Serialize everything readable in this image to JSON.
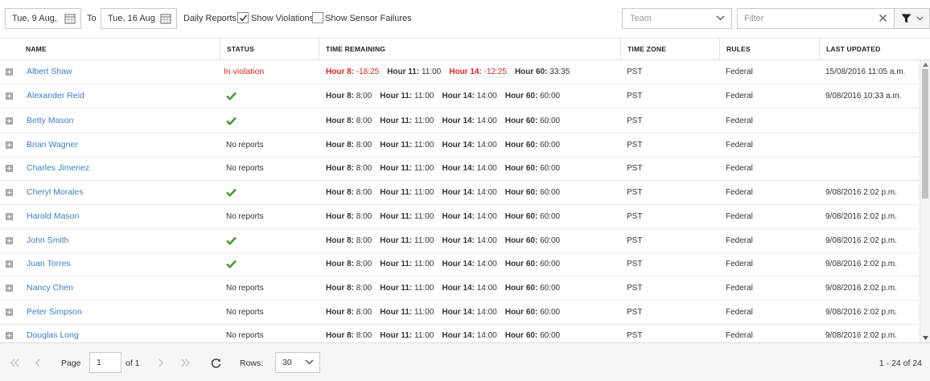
{
  "toolbar": {
    "from_date": "Tue, 9 Aug,",
    "to_label": "To",
    "to_date": "Tue, 16 Aug",
    "daily_reports_label": "Daily Reports:",
    "show_violations_label": "Show Violations",
    "show_violations_checked": true,
    "show_sensor_failures_label": "Show Sensor Failures",
    "show_sensor_failures_checked": false,
    "team_placeholder": "Team",
    "filter_placeholder": "Filter"
  },
  "columns": {
    "name": "NAME",
    "status": "STATUS",
    "time_remaining": "TIME REMAINING",
    "time_zone": "TIME ZONE",
    "rules": "RULES",
    "last_updated": "LAST UPDATED"
  },
  "rows": [
    {
      "name": "Albert Shaw",
      "status": "In violation",
      "status_type": "violation",
      "time": [
        {
          "label": "Hour 8:",
          "value": "-18:25",
          "red": true
        },
        {
          "label": "Hour 11:",
          "value": "11:00",
          "red": false
        },
        {
          "label": "Hour 14:",
          "value": "-12:25",
          "red": true
        },
        {
          "label": "Hour 60:",
          "value": "33:35",
          "red": false
        }
      ],
      "time_zone": "PST",
      "rules": "Federal",
      "last_updated": "15/08/2016 11:05 a.m."
    },
    {
      "name": "Alexander Reid",
      "status": "",
      "status_type": "ok",
      "time": [
        {
          "label": "Hour 8:",
          "value": "8:00"
        },
        {
          "label": "Hour 11:",
          "value": "11:00"
        },
        {
          "label": "Hour 14:",
          "value": "14:00"
        },
        {
          "label": "Hour 60:",
          "value": "60:00"
        }
      ],
      "time_zone": "PST",
      "rules": "Federal",
      "last_updated": "9/08/2016 10:33 a.m."
    },
    {
      "name": "Betty Mason",
      "status": "",
      "status_type": "ok",
      "time": [
        {
          "label": "Hour 8:",
          "value": "8:00"
        },
        {
          "label": "Hour 11:",
          "value": "11:00"
        },
        {
          "label": "Hour 14:",
          "value": "14:00"
        },
        {
          "label": "Hour 60:",
          "value": "60:00"
        }
      ],
      "time_zone": "PST",
      "rules": "Federal",
      "last_updated": ""
    },
    {
      "name": "Brian Wagner",
      "status": "No reports",
      "status_type": "none",
      "time": [
        {
          "label": "Hour 8:",
          "value": "8:00"
        },
        {
          "label": "Hour 11:",
          "value": "11:00"
        },
        {
          "label": "Hour 14:",
          "value": "14:00"
        },
        {
          "label": "Hour 60:",
          "value": "60:00"
        }
      ],
      "time_zone": "PST",
      "rules": "Federal",
      "last_updated": ""
    },
    {
      "name": "Charles Jimenez",
      "status": "No reports",
      "status_type": "none",
      "time": [
        {
          "label": "Hour 8:",
          "value": "8:00"
        },
        {
          "label": "Hour 11:",
          "value": "11:00"
        },
        {
          "label": "Hour 14:",
          "value": "14:00"
        },
        {
          "label": "Hour 60:",
          "value": "60:00"
        }
      ],
      "time_zone": "PST",
      "rules": "Federal",
      "last_updated": ""
    },
    {
      "name": "Cheryl Morales",
      "status": "",
      "status_type": "ok",
      "time": [
        {
          "label": "Hour 8:",
          "value": "8:00"
        },
        {
          "label": "Hour 11:",
          "value": "11:00"
        },
        {
          "label": "Hour 14:",
          "value": "14:00"
        },
        {
          "label": "Hour 60:",
          "value": "60:00"
        }
      ],
      "time_zone": "PST",
      "rules": "Federal",
      "last_updated": "9/08/2016 2:02 p.m."
    },
    {
      "name": "Harold Mason",
      "status": "No reports",
      "status_type": "none",
      "time": [
        {
          "label": "Hour 8:",
          "value": "8:00"
        },
        {
          "label": "Hour 11:",
          "value": "11:00"
        },
        {
          "label": "Hour 14:",
          "value": "14:00"
        },
        {
          "label": "Hour 60:",
          "value": "60:00"
        }
      ],
      "time_zone": "PST",
      "rules": "Federal",
      "last_updated": "9/08/2016 2:02 p.m."
    },
    {
      "name": "John Smith",
      "status": "",
      "status_type": "ok",
      "time": [
        {
          "label": "Hour 8:",
          "value": "8:00"
        },
        {
          "label": "Hour 11:",
          "value": "11:00"
        },
        {
          "label": "Hour 14:",
          "value": "14:00"
        },
        {
          "label": "Hour 60:",
          "value": "60:00"
        }
      ],
      "time_zone": "PST",
      "rules": "Federal",
      "last_updated": "9/08/2016 2:02 p.m."
    },
    {
      "name": "Juan Torres",
      "status": "",
      "status_type": "ok",
      "time": [
        {
          "label": "Hour 8:",
          "value": "8:00"
        },
        {
          "label": "Hour 11:",
          "value": "11:00"
        },
        {
          "label": "Hour 14:",
          "value": "14:00"
        },
        {
          "label": "Hour 60:",
          "value": "60:00"
        }
      ],
      "time_zone": "PST",
      "rules": "Federal",
      "last_updated": "9/08/2016 2:02 p.m."
    },
    {
      "name": "Nancy Chen",
      "status": "No reports",
      "status_type": "none",
      "time": [
        {
          "label": "Hour 8:",
          "value": "8:00"
        },
        {
          "label": "Hour 11:",
          "value": "11:00"
        },
        {
          "label": "Hour 14:",
          "value": "14:00"
        },
        {
          "label": "Hour 60:",
          "value": "60:00"
        }
      ],
      "time_zone": "PST",
      "rules": "Federal",
      "last_updated": "9/08/2016 2:02 p.m."
    },
    {
      "name": "Peter Simpson",
      "status": "No reports",
      "status_type": "none",
      "time": [
        {
          "label": "Hour 8:",
          "value": "8:00"
        },
        {
          "label": "Hour 11:",
          "value": "11:00"
        },
        {
          "label": "Hour 14:",
          "value": "14:00"
        },
        {
          "label": "Hour 60:",
          "value": "60:00"
        }
      ],
      "time_zone": "PST",
      "rules": "Federal",
      "last_updated": "9/08/2016 2:02 p.m."
    },
    {
      "name": "Douglas Long",
      "status": "No reports",
      "status_type": "none",
      "time": [
        {
          "label": "Hour 8:",
          "value": "8:00"
        },
        {
          "label": "Hour 11:",
          "value": "11:00"
        },
        {
          "label": "Hour 14:",
          "value": "14:00"
        },
        {
          "label": "Hour 60:",
          "value": "60:00"
        }
      ],
      "time_zone": "PST",
      "rules": "Federal",
      "last_updated": "9/08/2016 2:02 p.m."
    }
  ],
  "pager": {
    "page_label": "Page",
    "page_value": "1",
    "of_label": "of 1",
    "rows_label": "Rows:",
    "rows_value": "30",
    "range_label": "1 - 24 of 24"
  },
  "colors": {
    "link": "#3a7ec8",
    "violation": "#e02020",
    "check": "#4a9a3a"
  }
}
